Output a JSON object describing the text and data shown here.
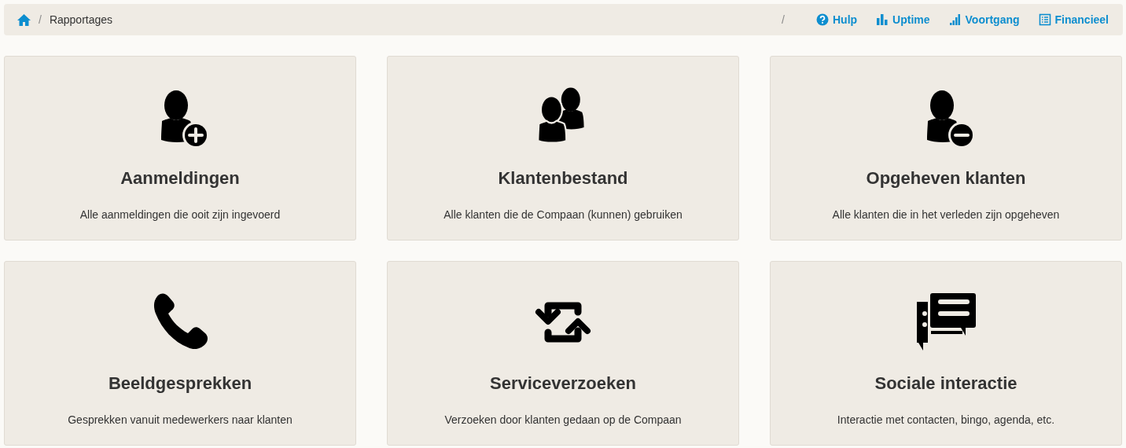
{
  "breadcrumb": [
    {
      "kind": "home"
    },
    {
      "kind": "divider",
      "text": "/"
    },
    {
      "kind": "current",
      "text": "Rapportages"
    }
  ],
  "links": [
    {
      "kind": "divider",
      "text": "/"
    },
    {
      "kind": "link",
      "text": "Hulp"
    },
    {
      "kind": "link",
      "text": "Uptime"
    },
    {
      "kind": "link",
      "text": "Voortgang"
    },
    {
      "kind": "link",
      "text": "Financieel"
    }
  ],
  "tiles": [
    {
      "title": "Aanmeldingen",
      "description": "Alle aanmeldingen die ooit zijn ingevoerd"
    },
    {
      "title": "Klantenbestand",
      "description": "Alle klanten die de Compaan (kunnen) gebruiken"
    },
    {
      "title": "Opgeheven klanten",
      "description": "Alle klanten die in het verleden zijn opgeheven"
    },
    {
      "title": "Beeldgesprekken",
      "description": "Gesprekken vanuit medewerkers naar klanten"
    },
    {
      "title": "Serviceverzoeken",
      "description": "Verzoeken door klanten gedaan op de Compaan"
    },
    {
      "title": "Sociale interactie",
      "description": "Interactie met contacten, bingo, agenda, etc."
    }
  ]
}
